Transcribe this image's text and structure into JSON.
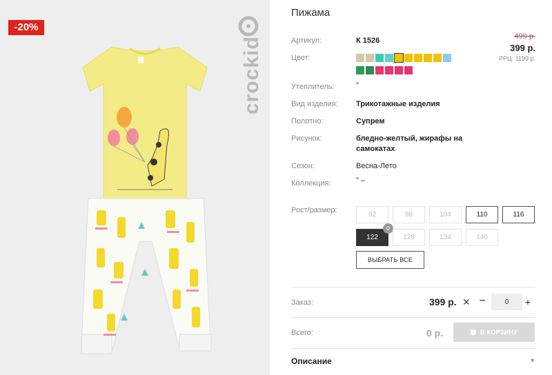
{
  "image": {
    "discount_badge": "-20%",
    "brand_watermark": "crockid"
  },
  "product": {
    "title": "Пижама",
    "article_label": "Артикул:",
    "article_value": "К 1526",
    "color_label": "Цвет:",
    "old_price": "499 р.",
    "price": "399 р.",
    "rrp": "РРЦ: 1199 р.",
    "insulation_label": "Утеплитель:",
    "insulation_value": "\"",
    "kind_label": "Вид изделия:",
    "kind_value": "Трикотажные изделия",
    "fabric_label": "Полотно:",
    "fabric_value": "Супрем",
    "pattern_label": "Рисунок:",
    "pattern_value": "бледно-желтый, жирафы на самокатах",
    "season_label": "Сезон:",
    "season_value": "Весна-Лето",
    "collection_label": "Коллекция:",
    "collection_value": "\" –"
  },
  "colors": {
    "swatches": [
      "#d6c8a6",
      "#d6c8a6",
      "#3fc8b8",
      "#5cd3c6",
      "#f2c200",
      "#f2c200",
      "#f2c200",
      "#f2c200",
      "#f2c200",
      "#8ccaf0",
      "#2e9a58",
      "#2e8a4e",
      "#e8356f",
      "#e8356f",
      "#e8356f",
      "#e8356f"
    ],
    "selected_index": 4
  },
  "sizes": {
    "label": "Рост/размер:",
    "options": [
      {
        "label": "92",
        "state": "unavailable"
      },
      {
        "label": "98",
        "state": "unavailable"
      },
      {
        "label": "104",
        "state": "unavailable"
      },
      {
        "label": "110",
        "state": "available"
      },
      {
        "label": "116",
        "state": "available"
      },
      {
        "label": "122",
        "state": "selected",
        "count": "0"
      },
      {
        "label": "128",
        "state": "unavailable"
      },
      {
        "label": "134",
        "state": "unavailable"
      },
      {
        "label": "140",
        "state": "unavailable"
      }
    ],
    "select_all_label": "ВЫБРАТЬ ВСЕ"
  },
  "order": {
    "label": "Заказ:",
    "price": "399 р.",
    "times": "✕",
    "minus": "−",
    "quantity": "0",
    "plus": "+"
  },
  "total": {
    "label": "Всего:",
    "value": "0 р.",
    "cart_button": "В КОРЗИНУ"
  },
  "description": {
    "label": "Описание",
    "chevron": "▼"
  }
}
